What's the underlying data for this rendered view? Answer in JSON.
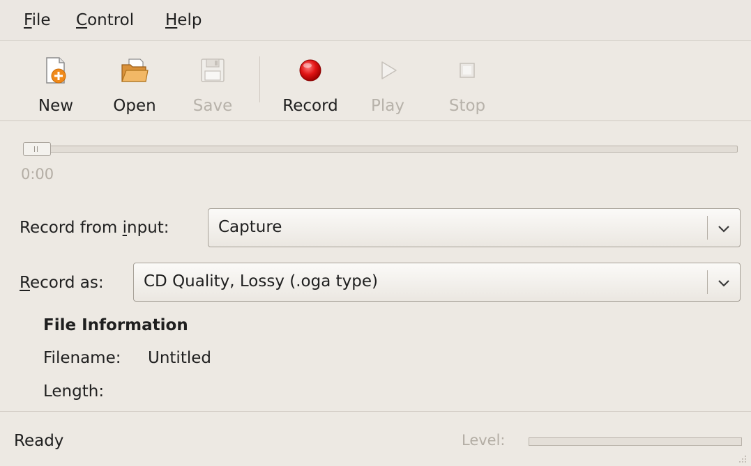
{
  "menubar": {
    "items": [
      {
        "label": "File",
        "mnemonic": "F",
        "rest": "ile"
      },
      {
        "label": "Control",
        "mnemonic": "C",
        "rest": "ontrol"
      },
      {
        "label": "Help",
        "mnemonic": "H",
        "rest": "elp"
      }
    ]
  },
  "toolbar": {
    "new": {
      "label": "New",
      "icon": "new-file-icon"
    },
    "open": {
      "label": "Open",
      "icon": "open-folder-icon"
    },
    "save": {
      "label": "Save",
      "icon": "save-icon",
      "enabled": false
    },
    "record": {
      "label": "Record",
      "icon": "record-icon"
    },
    "play": {
      "label": "Play",
      "icon": "play-icon",
      "enabled": false
    },
    "stop": {
      "label": "Stop",
      "icon": "stop-icon",
      "enabled": false
    }
  },
  "seek": {
    "time": "0:00",
    "position": 0
  },
  "record_from": {
    "label_pre": "Record from ",
    "label_mn": "i",
    "label_post": "nput:",
    "value": "Capture"
  },
  "record_as": {
    "label_mn": "R",
    "label_post": "ecord as:",
    "value": "CD Quality, Lossy (.oga type)"
  },
  "file_info": {
    "title": "File Information",
    "filename_key": "Filename:",
    "filename_value": "Untitled",
    "length_key": "Length:",
    "length_value": ""
  },
  "statusbar": {
    "status": "Ready",
    "level_label": "Level:",
    "level": 0
  },
  "colors": {
    "record_red": "#d90f0f",
    "disabled_text": "#b7b2aa"
  }
}
